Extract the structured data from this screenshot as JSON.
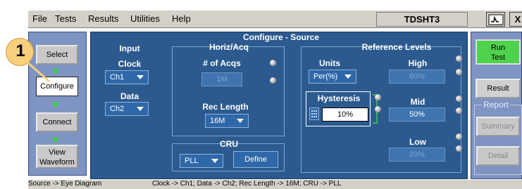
{
  "menu": {
    "file": "File",
    "tests": "Tests",
    "results": "Results",
    "utilities": "Utilities",
    "help": "Help"
  },
  "app_name": "TDSHT3",
  "window_buttons": {
    "close": "X"
  },
  "left_nav": {
    "select": "Select",
    "configure": "Configure",
    "connect": "Connect",
    "view1": "View",
    "view2": "Waveform"
  },
  "callout_number": "1",
  "panel_title": "Configure - Source",
  "input": {
    "title": "Input",
    "clock_label": "Clock",
    "clock_value": "Ch1",
    "data_label": "Data",
    "data_value": "Ch2"
  },
  "horiz": {
    "title": "Horiz/Acq",
    "acqs_label": "# of Acqs",
    "acqs_value": "1M",
    "rec_label": "Rec Length",
    "rec_value": "16M"
  },
  "cru": {
    "title": "CRU",
    "value": "PLL",
    "define": "Define"
  },
  "ref": {
    "title": "Reference Levels",
    "units_label": "Units",
    "units_value": "Per(%)",
    "high_label": "High",
    "high_value": "80%",
    "hyst_label": "Hysteresis",
    "hyst_value": "10%",
    "mid_label": "Mid",
    "mid_value": "50%",
    "low_label": "Low",
    "low_value": "20%"
  },
  "right": {
    "run1": "Run",
    "run2": "Test",
    "result": "Result",
    "report": "Report",
    "summary": "Summary",
    "detail": "Detail"
  },
  "status": {
    "left": "Source -> Eye Diagram",
    "right": "Clock -> Ch1; Data -> Ch2; Rec Length -> 16M; CRU -> PLL"
  }
}
